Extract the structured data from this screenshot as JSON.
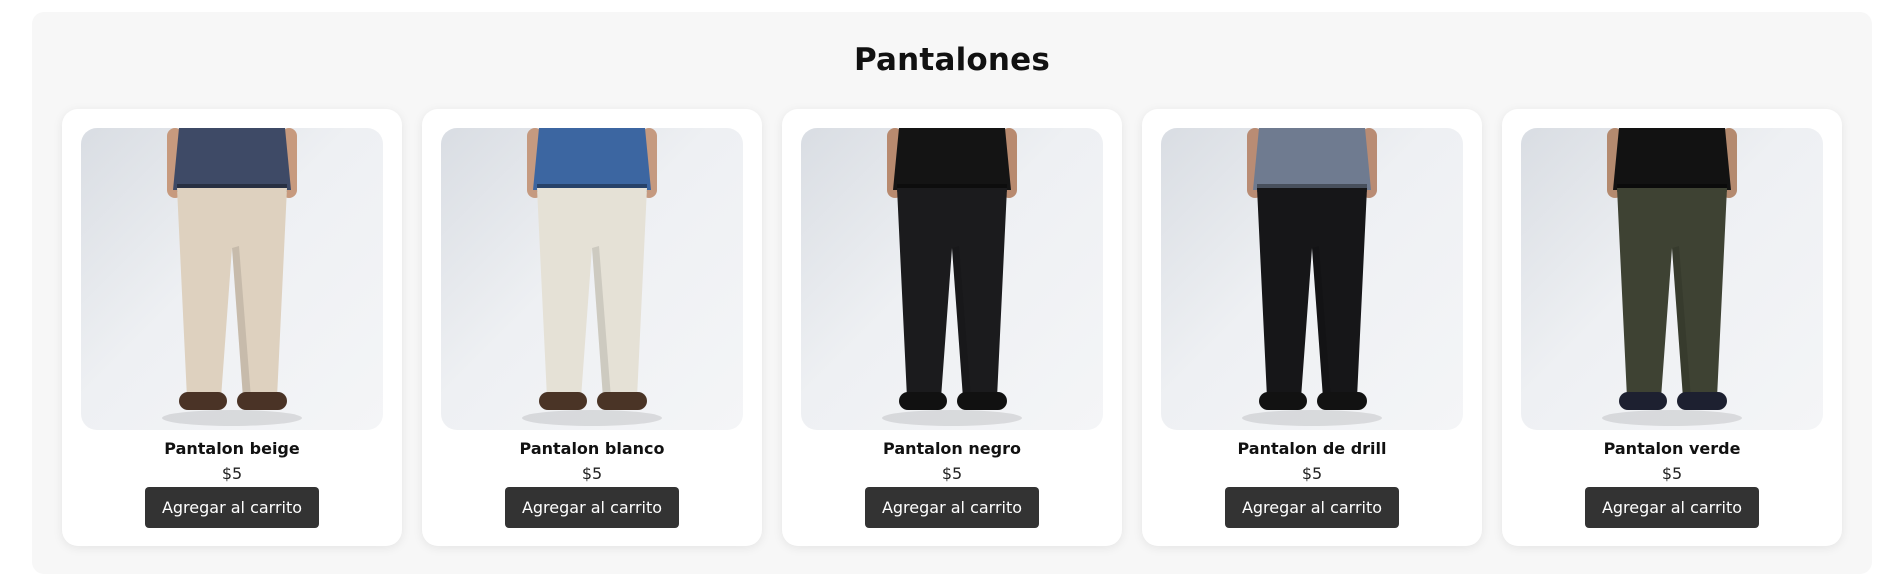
{
  "section": {
    "title": "Pantalones"
  },
  "products": [
    {
      "name": "Pantalon beige",
      "price": "$5",
      "button_label": "Agregar al carrito",
      "image_icon": "beige-pants-photo",
      "colors": {
        "shirt": "#3e4a66",
        "pants": "#ded1bf",
        "shoes": "#4a3326",
        "skin": "#c79a7e"
      }
    },
    {
      "name": "Pantalon blanco",
      "price": "$5",
      "button_label": "Agregar al carrito",
      "image_icon": "white-pants-photo",
      "colors": {
        "shirt": "#3c66a1",
        "pants": "#e5e1d6",
        "shoes": "#4a3426",
        "skin": "#c59a80"
      }
    },
    {
      "name": "Pantalon negro",
      "price": "$5",
      "button_label": "Agregar al carrito",
      "image_icon": "black-pants-photo",
      "colors": {
        "shirt": "#141414",
        "pants": "#1b1b1d",
        "shoes": "#111111",
        "skin": "#b88a6f"
      }
    },
    {
      "name": "Pantalon de drill",
      "price": "$5",
      "button_label": "Agregar al carrito",
      "image_icon": "drill-pants-photo",
      "colors": {
        "shirt": "#6f7b90",
        "pants": "#161618",
        "shoes": "#121212",
        "skin": "#b98c74"
      }
    },
    {
      "name": "Pantalon verde",
      "price": "$5",
      "button_label": "Agregar al carrito",
      "image_icon": "green-pants-photo",
      "colors": {
        "shirt": "#121212",
        "pants": "#3e4233",
        "shoes": "#1d2030",
        "skin": "#b48a6f"
      }
    }
  ]
}
